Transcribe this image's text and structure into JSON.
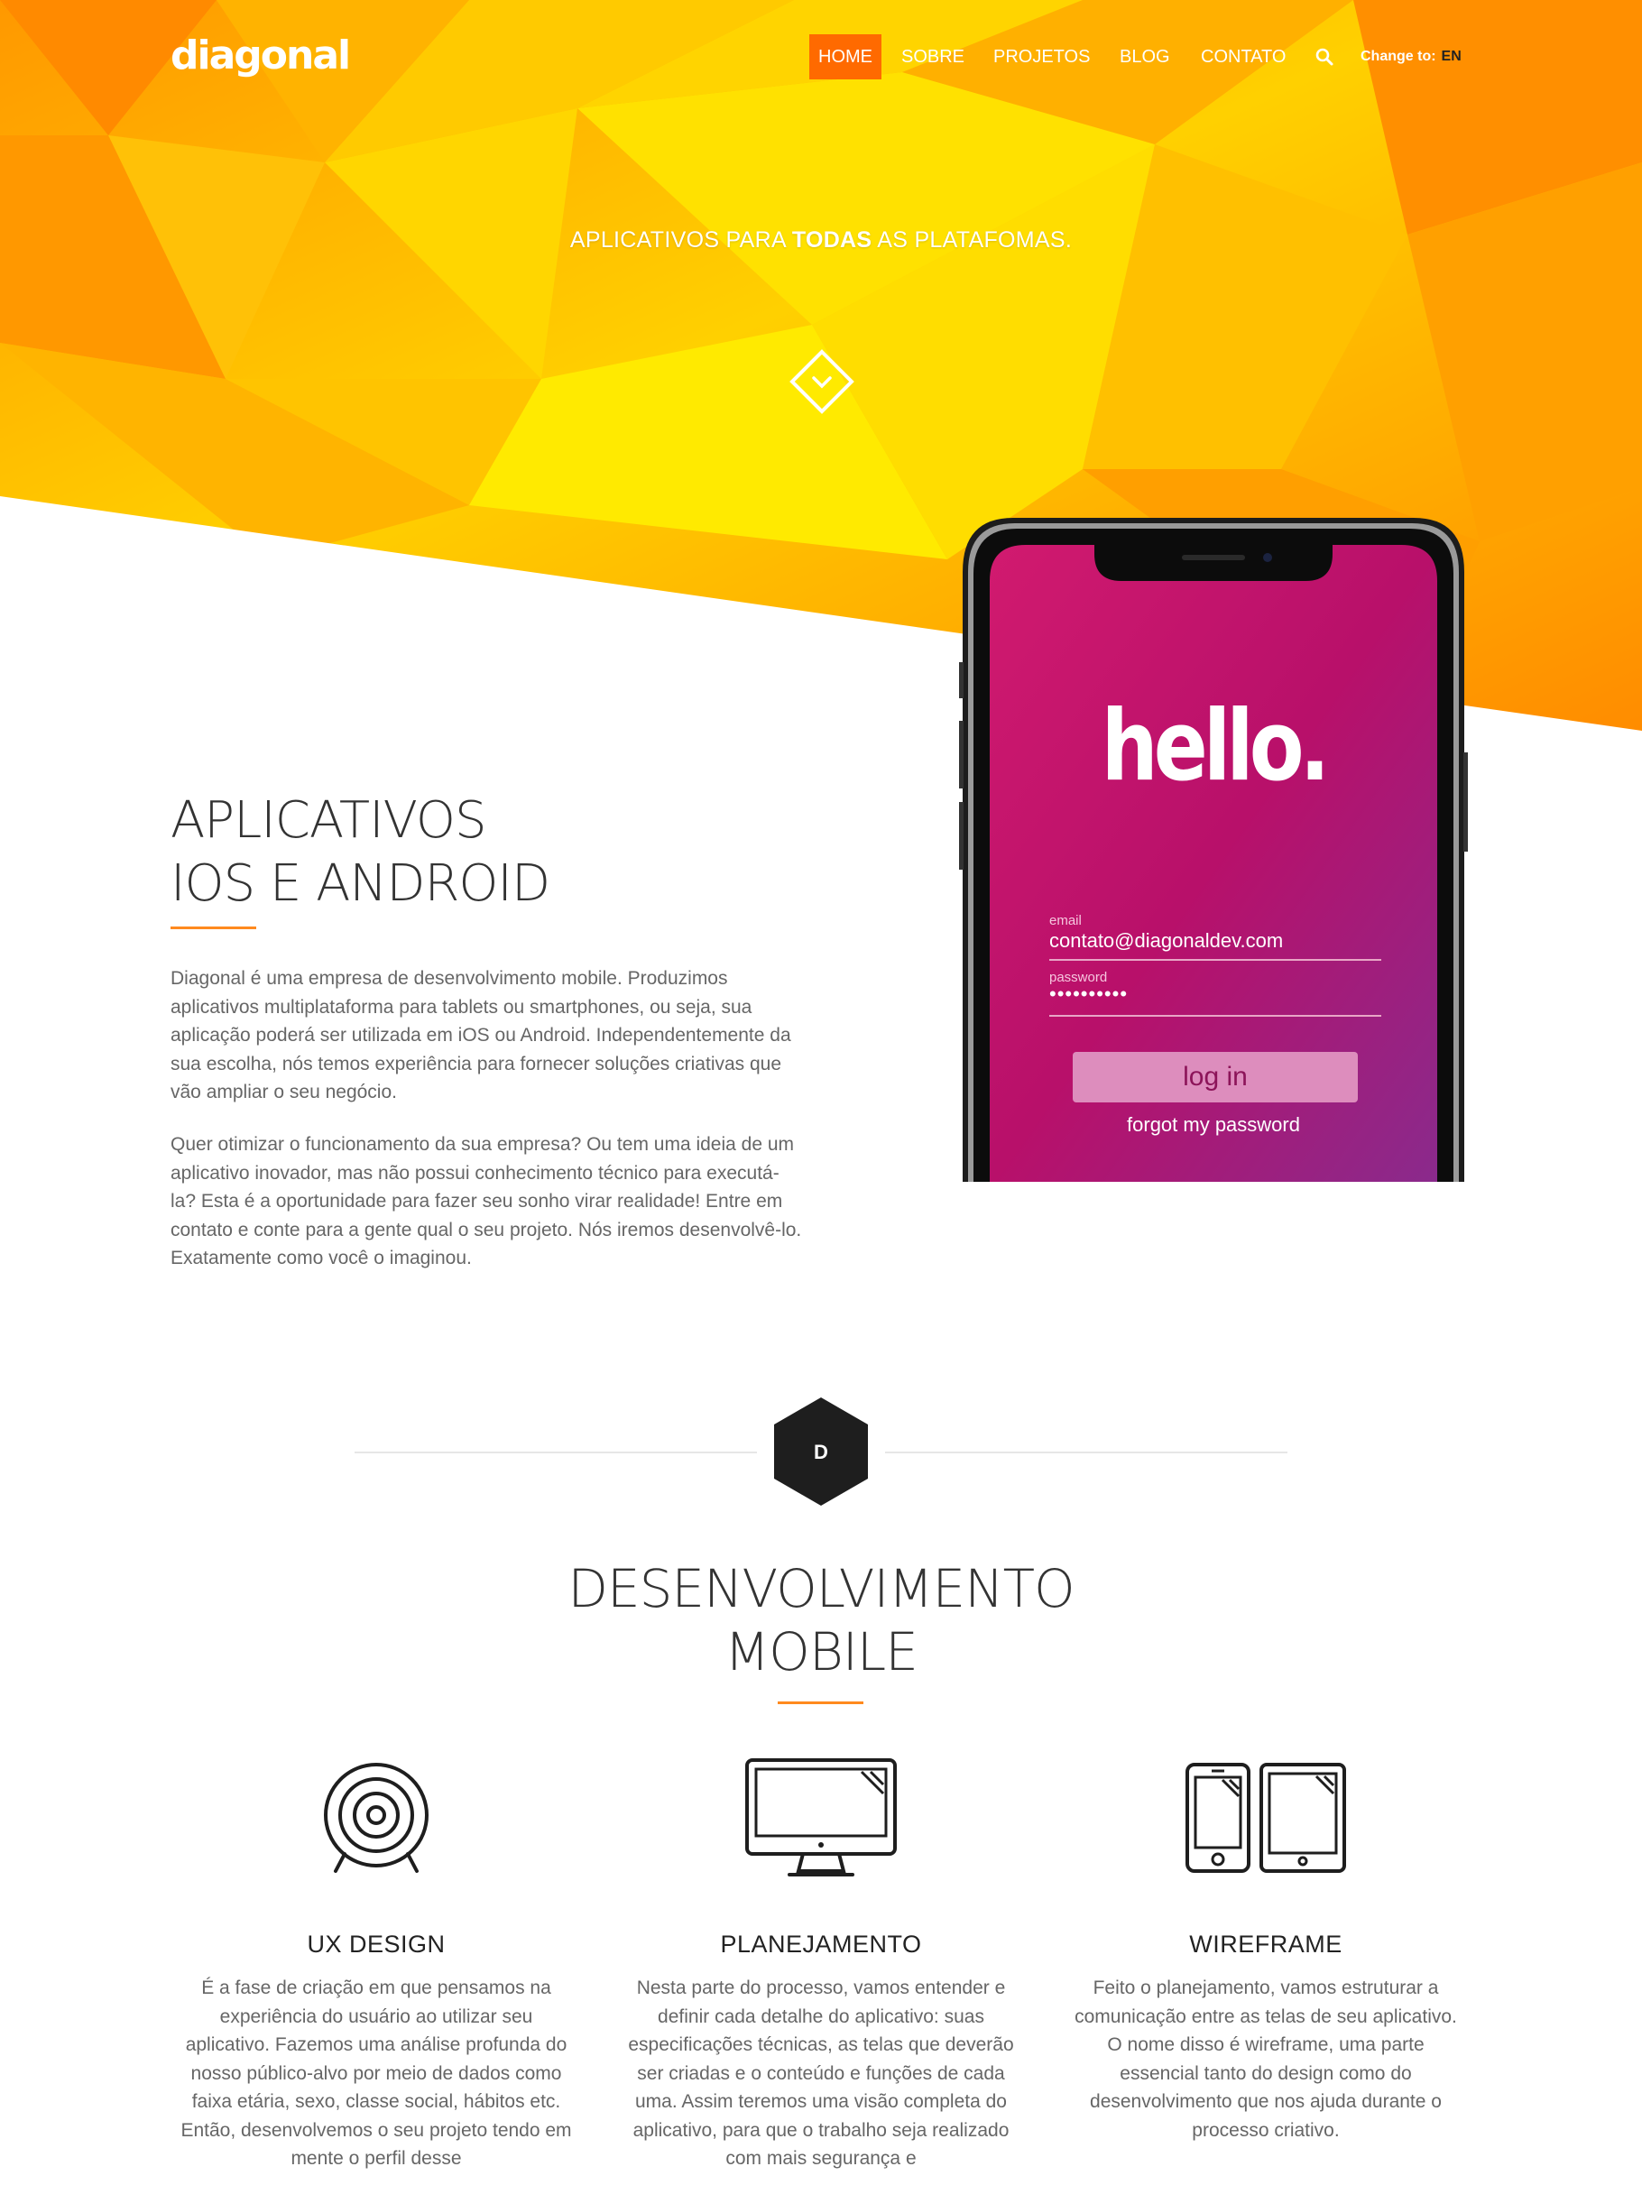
{
  "brand": {
    "logo_text": "diagonal"
  },
  "nav": {
    "items": [
      {
        "label": "HOME",
        "active": true
      },
      {
        "label": "SOBRE",
        "active": false
      },
      {
        "label": "PROJETOS",
        "active": false
      },
      {
        "label": "BLOG",
        "active": false
      },
      {
        "label": "CONTATO",
        "active": false
      }
    ],
    "search_icon": "search-icon",
    "language_label": "Change to:",
    "language_value": "EN"
  },
  "hero": {
    "tagline_before": "APLICATIVOS PARA ",
    "tagline_bold": "TODAS",
    "tagline_after": " AS PLATAFOMAS.",
    "scroll_icon": "chevron-down-icon"
  },
  "phone_mockup": {
    "greeting": "hello.",
    "email_label": "email",
    "email_value": "contato@diagonaldev.com",
    "password_label": "password",
    "password_value": "••••••••••",
    "login_button": "log in",
    "forgot_link": "forgot my password"
  },
  "intro": {
    "title_line1": "APLICATIVOS",
    "title_line2": "IOS E ANDROID",
    "paragraph1": "Diagonal é uma empresa de desenvolvimento mobile. Produzimos aplicativos multiplataforma para tablets ou smartphones, ou seja, sua aplicação poderá ser utilizada em iOS ou Android. Independentemente da sua escolha, nós temos experiência para fornecer soluções criativas que vão ampliar o seu negócio.",
    "paragraph2": "Quer otimizar o funcionamento da sua empresa? Ou tem uma ideia de um aplicativo inovador, mas não possui conhecimento técnico para executá-la? Esta é a oportunidade para fazer seu sonho virar realidade! Entre em contato e conte para a gente qual o seu projeto. Nós iremos desenvolvê-lo. Exatamente como você o imaginou."
  },
  "divider": {
    "badge_letter": "D"
  },
  "section": {
    "title_line1": "DESENVOLVIMENTO",
    "title_line2": "MOBILE"
  },
  "features": [
    {
      "icon": "target-icon",
      "title": "UX DESIGN",
      "text": "É a fase de criação em que pensamos na experiência do usuário ao utilizar seu aplicativo. Fazemos uma análise profunda do nosso público-alvo por meio de dados como faixa etária, sexo, classe social, hábitos etc. Então, desenvolvemos o seu projeto tendo em mente o perfil desse"
    },
    {
      "icon": "desktop-monitor-icon",
      "title": "PLANEJAMENTO",
      "text": "Nesta parte do processo, vamos entender e definir cada detalhe do aplicativo: suas especificações técnicas, as telas que deverão ser criadas e o conteúdo e funções de cada uma. Assim teremos uma visão completa do aplicativo, para que o trabalho seja realizado com mais segurança e"
    },
    {
      "icon": "phone-tablet-icon",
      "title": "WIREFRAME",
      "text": "Feito o planejamento, vamos estruturar a comunicação entre as telas de seu aplicativo. O nome disso é wireframe, uma parte essencial tanto do design como do desenvolvimento que nos ajuda durante o processo criativo."
    }
  ],
  "colors": {
    "accent_orange": "#ff6a00",
    "rule_orange": "#ff8a1f",
    "hero_yellow": "#ffe600",
    "phone_magenta": "#c8106e",
    "text_dark": "#333333",
    "text_body": "#666666"
  }
}
